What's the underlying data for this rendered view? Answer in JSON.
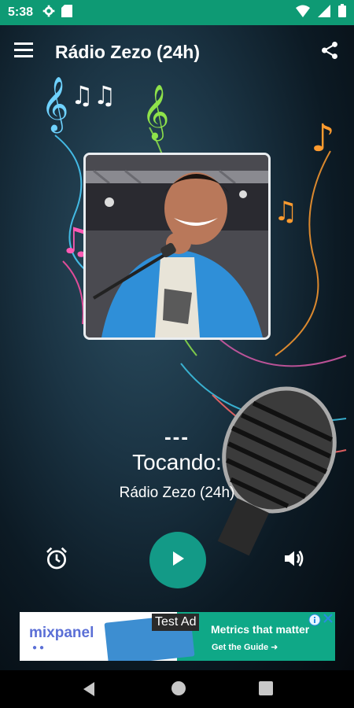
{
  "status_bar": {
    "time": "5:38",
    "left_icons": [
      "gear-icon",
      "sd-card-icon"
    ],
    "right_icons": [
      "wifi-icon",
      "signal-icon",
      "battery-icon"
    ],
    "color": "#0e9a74"
  },
  "toolbar": {
    "title": "Rádio Zezo (24h)",
    "menu_icon": "hamburger-menu-icon",
    "share_icon": "share-icon"
  },
  "player": {
    "cover_alt": "album-cover",
    "track_title": "---",
    "status_label": "Tocando:",
    "station_name": "Rádio Zezo (24h)",
    "alarm_icon": "alarm-clock-icon",
    "play_icon": "play-icon",
    "volume_icon": "volume-icon",
    "accent": "#139a87"
  },
  "ad": {
    "brand": "mixpanel",
    "test_label": "Test Ad",
    "headline": "Metrics that matter",
    "cta": "Get the Guide ➜",
    "accent": "#0fa887"
  },
  "nav_bar": {
    "icons": [
      "back-icon",
      "home-icon",
      "recents-icon"
    ]
  }
}
